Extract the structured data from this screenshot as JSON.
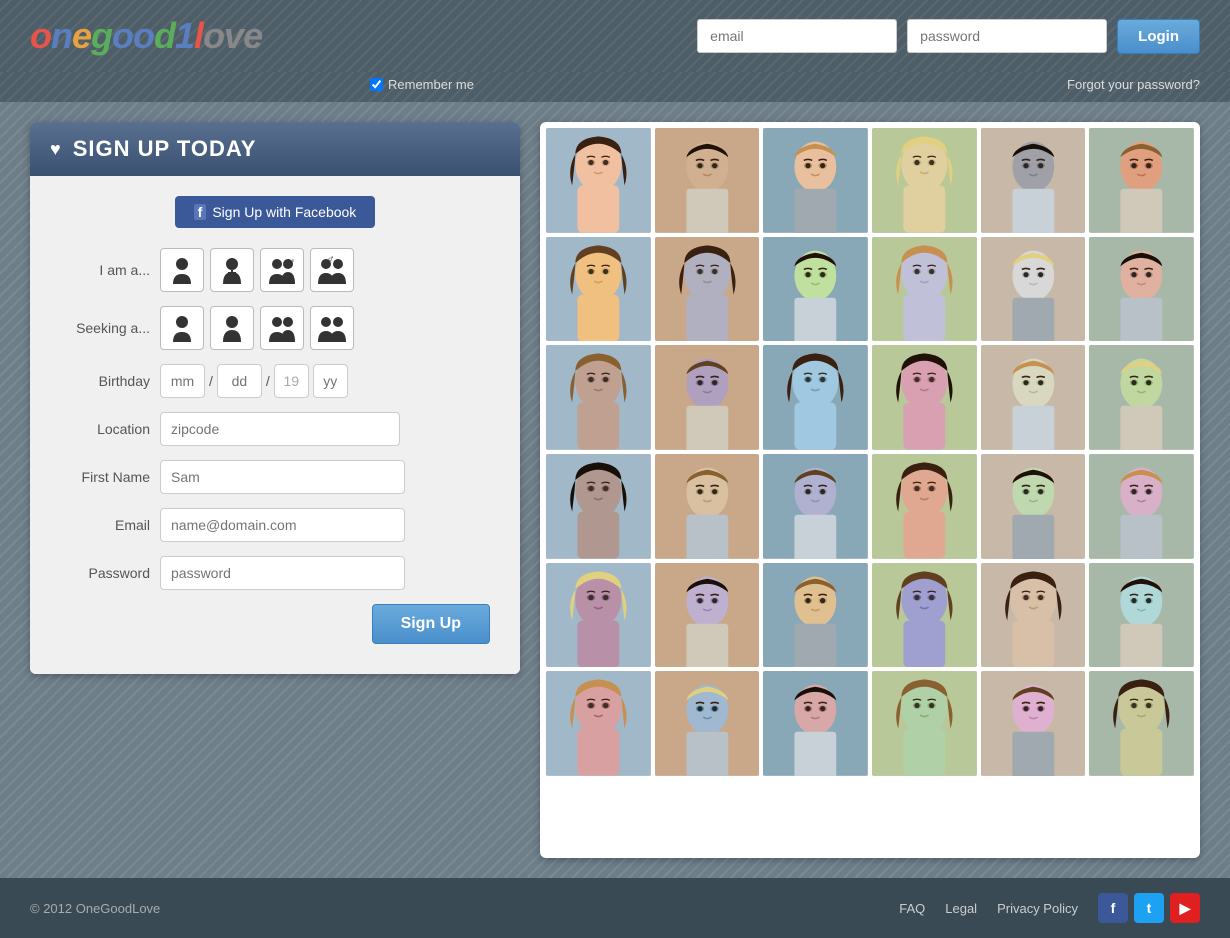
{
  "header": {
    "logo": {
      "text": "onegoodlove",
      "parts": [
        "one",
        "good",
        "1",
        "love"
      ]
    },
    "email_placeholder": "email",
    "password_placeholder": "password",
    "login_label": "Login",
    "remember_me_label": "Remember me",
    "forgot_password_label": "Forgot your password?"
  },
  "signup": {
    "title": "SIGN UP TODAY",
    "facebook_btn": "Sign Up with Facebook",
    "iam_label": "I am a...",
    "seeking_label": "Seeking a...",
    "birthday_label": "Birthday",
    "birthday_mm": "mm",
    "birthday_dd": "dd",
    "birthday_19": "19",
    "birthday_yy": "yy",
    "location_label": "Location",
    "location_placeholder": "zipcode",
    "firstname_label": "First Name",
    "firstname_placeholder": "Sam",
    "email_label": "Email",
    "email_placeholder": "name@domain.com",
    "password_label": "Password",
    "password_placeholder": "password",
    "signup_btn": "Sign Up"
  },
  "footer": {
    "copyright": "© 2012 OneGoodLove",
    "links": [
      "FAQ",
      "Legal",
      "Privacy Policy"
    ]
  },
  "photos": {
    "grid_rows": 6,
    "grid_cols": 6,
    "colors": [
      "#c8a090",
      "#a0b0c0",
      "#c0a080",
      "#d0c080",
      "#888",
      "#c08080",
      "#e0b080",
      "#9090a0",
      "#a0c090",
      "#b0b0c0",
      "#c0c0d0",
      "#d0a090",
      "#b09080",
      "#9080a0",
      "#a0c0d0",
      "#c08090",
      "#d0d0c0",
      "#b0c0a0",
      "#908080",
      "#c0b090",
      "#a0a0c0",
      "#d09080",
      "#b0c0b0",
      "#c0a0b0",
      "#a08090",
      "#b0a0c0",
      "#d0b080",
      "#9090c0",
      "#c0b0a0",
      "#a0c0c0",
      "#b08080",
      "#90a0b0",
      "#c09090",
      "#a0b090",
      "#d0a0b0",
      "#b0b080"
    ]
  }
}
